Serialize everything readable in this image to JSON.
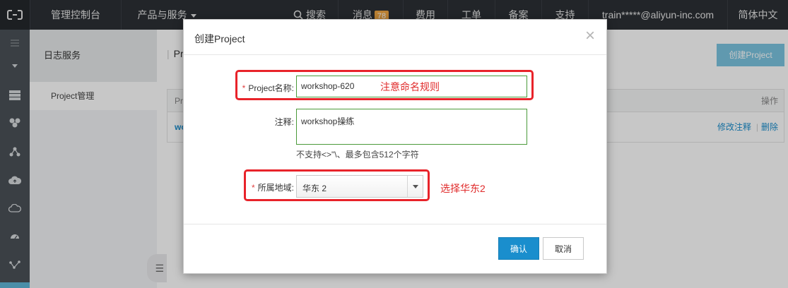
{
  "topbar": {
    "console": "管理控制台",
    "products": "产品与服务",
    "search": "搜索",
    "messages": "消息",
    "messages_count": "78",
    "billing": "费用",
    "tickets": "工单",
    "icp": "备案",
    "support": "支持",
    "account": "train*****@aliyun-inc.com",
    "language": "简体中文"
  },
  "sidebar": {
    "title": "日志服务",
    "items": [
      {
        "label": "Project管理"
      }
    ]
  },
  "main": {
    "breadcrumb": "Pr",
    "create_button": "创建Project",
    "table": {
      "col_name": "Pr",
      "col_actions": "操作",
      "row_name": "wo",
      "edit_note": "修改注释",
      "separator": "|",
      "delete": "删除"
    }
  },
  "modal": {
    "title": "创建Project",
    "close": "×",
    "name_label": "Project名称:",
    "name_value": "workshop-620",
    "note_label": "注释:",
    "note_value": "workshop操练",
    "note_hint": "不支持<>\"\\、最多包含512个字符",
    "region_label": "所属地域:",
    "region_value": "华东 2",
    "required_mark": "*",
    "confirm": "确认",
    "cancel": "取消"
  },
  "annotations": {
    "name_hint": "注意命名规则",
    "region_hint": "选择华东2"
  },
  "colors": {
    "topbar": "#2c3035",
    "rail": "#4b5158",
    "primary": "#1a8ecd",
    "annotation_red": "#e8232a",
    "field_border_green": "#4a9a3a"
  }
}
